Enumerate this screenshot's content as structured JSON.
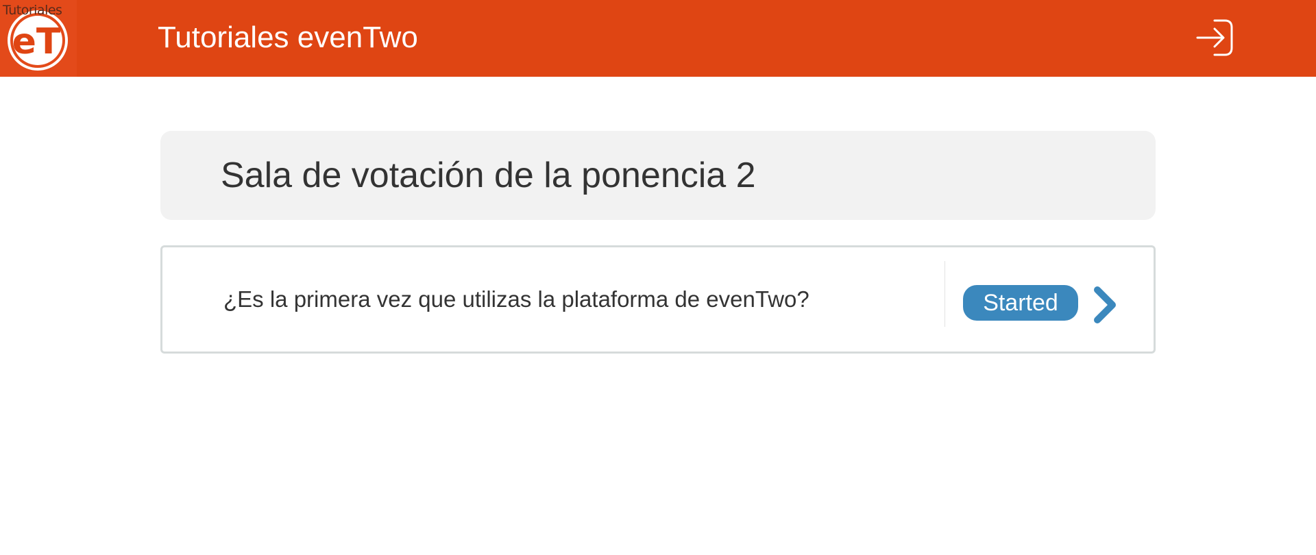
{
  "header": {
    "logo_caption": "Tutoriales",
    "logo_text": "eT",
    "title": "Tutoriales evenTwo",
    "logout_icon": "logout-arrow-icon",
    "background_color": "#df4513"
  },
  "main": {
    "page_title": "Sala de votación de la ponencia 2",
    "question": "¿Es la primera vez que utilizas la plataforma de evenTwo?",
    "started_label": "Started",
    "started_color": "#3b88bd",
    "chevron_icon": "chevron-right-icon"
  }
}
